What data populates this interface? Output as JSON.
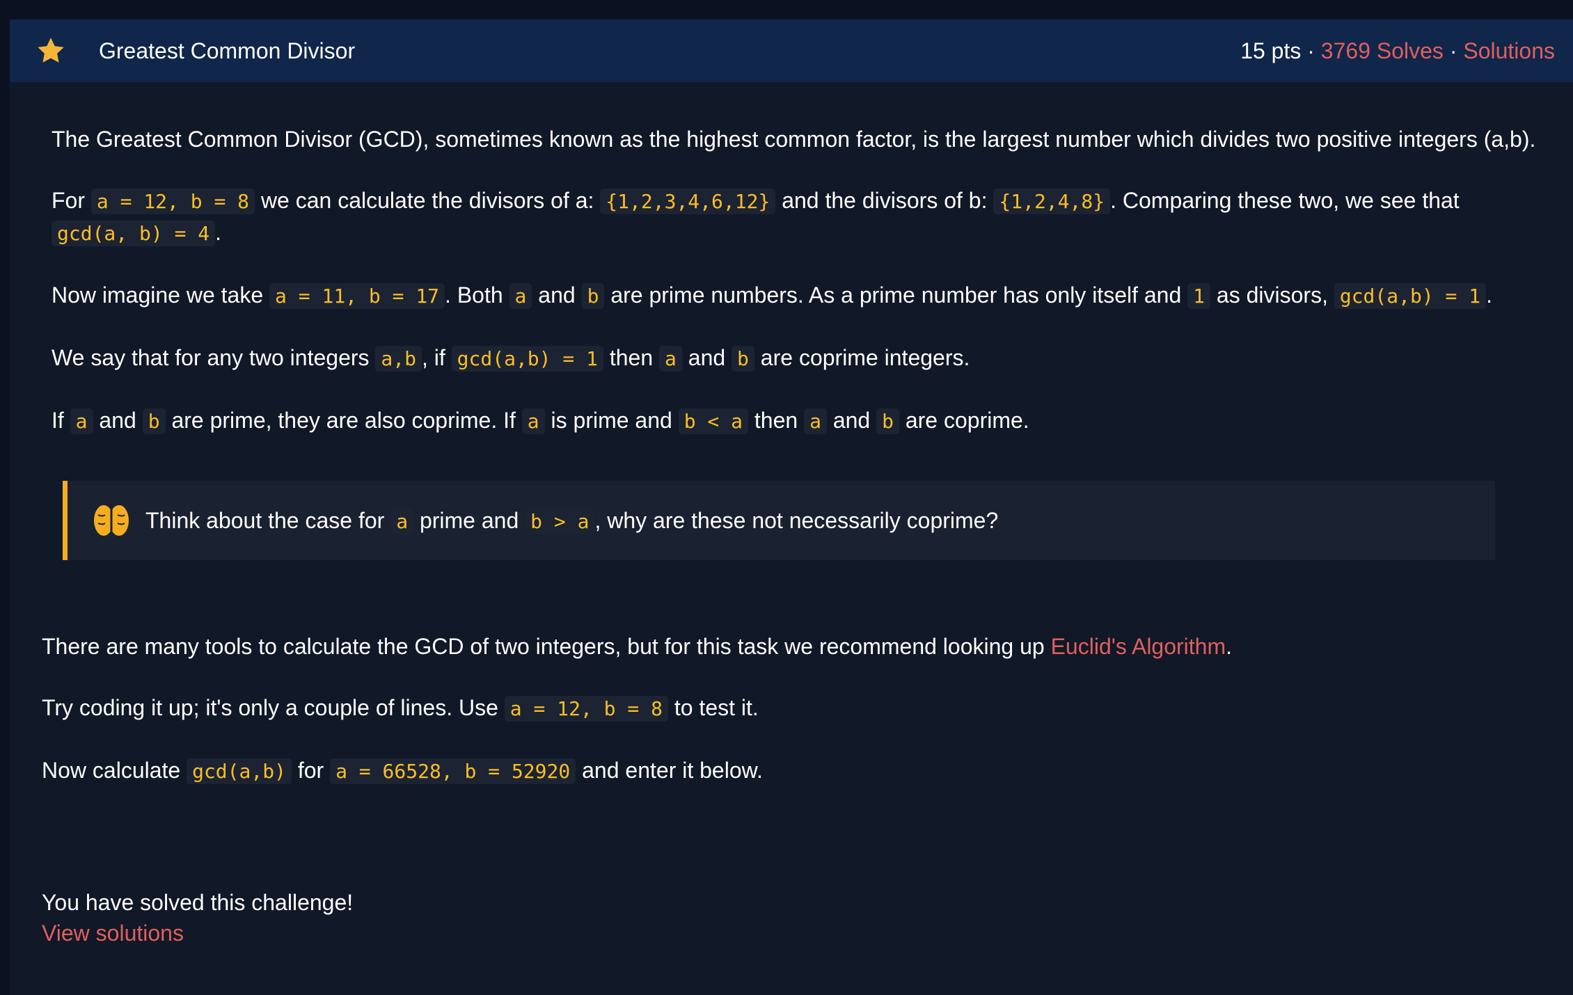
{
  "header": {
    "title": "Greatest Common Divisor",
    "points": "15 pts",
    "sep1": " · ",
    "solves": "3769 Solves",
    "sep2": " · ",
    "solutions": "Solutions",
    "star_color": "#f5b43a"
  },
  "p1": {
    "text": "The Greatest Common Divisor (GCD), sometimes known as the highest common factor, is the largest number which divides two positive integers (a,b)."
  },
  "p2": {
    "t1": "For ",
    "c1": "a = 12, b = 8",
    "t2": " we can calculate the divisors of a: ",
    "c2": "{1,2,3,4,6,12}",
    "t3": " and the divisors of b: ",
    "c3": "{1,2,4,8}",
    "t4": ". Comparing these two, we see that ",
    "c4": "gcd(a, b) = 4",
    "t5": "."
  },
  "p3": {
    "t1": "Now imagine we take ",
    "c1": "a = 11, b = 17",
    "t2": ". Both ",
    "c2": "a",
    "t3": " and ",
    "c3": "b",
    "t4": " are prime numbers. As a prime number has only itself and ",
    "c4": "1",
    "t5": " as divisors, ",
    "c5": "gcd(a,b) = 1",
    "t6": "."
  },
  "p4": {
    "t1": "We say that for any two integers ",
    "c1": "a,b",
    "t2": ", if ",
    "c2": "gcd(a,b) = 1",
    "t3": " then ",
    "c3": "a",
    "t4": " and ",
    "c4": "b",
    "t5": " are coprime integers."
  },
  "p5": {
    "t1": "If ",
    "c1": "a",
    "t2": " and ",
    "c2": "b",
    "t3": " are prime, they are also coprime. If ",
    "c3": "a",
    "t4": " is prime and ",
    "c4": "b < a",
    "t5": " then ",
    "c5": "a",
    "t6": " and ",
    "c6": "b",
    "t7": " are coprime."
  },
  "hint": {
    "icon": "brain-icon",
    "t1": "Think about the case for ",
    "c1": "a",
    "t2": " prime and ",
    "c2": "b > a",
    "t3": ", why are these not necessarily coprime?"
  },
  "p6": {
    "t1": "There are many tools to calculate the GCD of two integers, but for this task we recommend looking up ",
    "link": "Euclid's Algorithm",
    "t2": "."
  },
  "p7": {
    "t1": "Try coding it up; it's only a couple of lines. Use ",
    "c1": "a = 12, b = 8",
    "t2": " to test it."
  },
  "p8": {
    "t1": "Now calculate ",
    "c1": "gcd(a,b)",
    "t2": " for ",
    "c2": "a = 66528, b = 52920",
    "t3": " and enter it below."
  },
  "solved": {
    "message": "You have solved this challenge!",
    "link": "View solutions"
  },
  "colors": {
    "background": "#0b1120",
    "panel": "#111827",
    "header": "#10264a",
    "accent_link": "#e0605e",
    "code_text": "#fbbf24",
    "hint_border": "#f5ad1f"
  }
}
